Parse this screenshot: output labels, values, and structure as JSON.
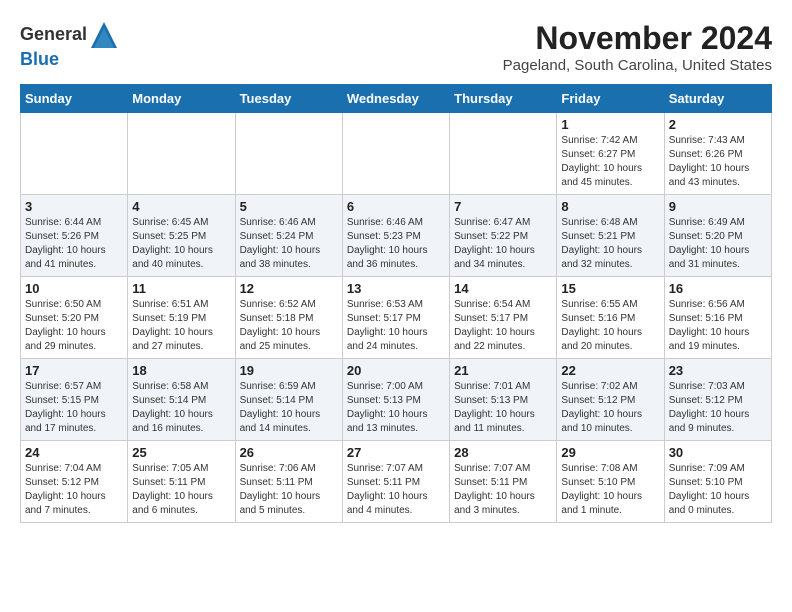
{
  "header": {
    "logo_line1": "General",
    "logo_line2": "Blue",
    "title": "November 2024",
    "subtitle": "Pageland, South Carolina, United States"
  },
  "weekdays": [
    "Sunday",
    "Monday",
    "Tuesday",
    "Wednesday",
    "Thursday",
    "Friday",
    "Saturday"
  ],
  "weeks": [
    [
      {
        "day": "",
        "info": ""
      },
      {
        "day": "",
        "info": ""
      },
      {
        "day": "",
        "info": ""
      },
      {
        "day": "",
        "info": ""
      },
      {
        "day": "",
        "info": ""
      },
      {
        "day": "1",
        "info": "Sunrise: 7:42 AM\nSunset: 6:27 PM\nDaylight: 10 hours\nand 45 minutes."
      },
      {
        "day": "2",
        "info": "Sunrise: 7:43 AM\nSunset: 6:26 PM\nDaylight: 10 hours\nand 43 minutes."
      }
    ],
    [
      {
        "day": "3",
        "info": "Sunrise: 6:44 AM\nSunset: 5:26 PM\nDaylight: 10 hours\nand 41 minutes."
      },
      {
        "day": "4",
        "info": "Sunrise: 6:45 AM\nSunset: 5:25 PM\nDaylight: 10 hours\nand 40 minutes."
      },
      {
        "day": "5",
        "info": "Sunrise: 6:46 AM\nSunset: 5:24 PM\nDaylight: 10 hours\nand 38 minutes."
      },
      {
        "day": "6",
        "info": "Sunrise: 6:46 AM\nSunset: 5:23 PM\nDaylight: 10 hours\nand 36 minutes."
      },
      {
        "day": "7",
        "info": "Sunrise: 6:47 AM\nSunset: 5:22 PM\nDaylight: 10 hours\nand 34 minutes."
      },
      {
        "day": "8",
        "info": "Sunrise: 6:48 AM\nSunset: 5:21 PM\nDaylight: 10 hours\nand 32 minutes."
      },
      {
        "day": "9",
        "info": "Sunrise: 6:49 AM\nSunset: 5:20 PM\nDaylight: 10 hours\nand 31 minutes."
      }
    ],
    [
      {
        "day": "10",
        "info": "Sunrise: 6:50 AM\nSunset: 5:20 PM\nDaylight: 10 hours\nand 29 minutes."
      },
      {
        "day": "11",
        "info": "Sunrise: 6:51 AM\nSunset: 5:19 PM\nDaylight: 10 hours\nand 27 minutes."
      },
      {
        "day": "12",
        "info": "Sunrise: 6:52 AM\nSunset: 5:18 PM\nDaylight: 10 hours\nand 25 minutes."
      },
      {
        "day": "13",
        "info": "Sunrise: 6:53 AM\nSunset: 5:17 PM\nDaylight: 10 hours\nand 24 minutes."
      },
      {
        "day": "14",
        "info": "Sunrise: 6:54 AM\nSunset: 5:17 PM\nDaylight: 10 hours\nand 22 minutes."
      },
      {
        "day": "15",
        "info": "Sunrise: 6:55 AM\nSunset: 5:16 PM\nDaylight: 10 hours\nand 20 minutes."
      },
      {
        "day": "16",
        "info": "Sunrise: 6:56 AM\nSunset: 5:16 PM\nDaylight: 10 hours\nand 19 minutes."
      }
    ],
    [
      {
        "day": "17",
        "info": "Sunrise: 6:57 AM\nSunset: 5:15 PM\nDaylight: 10 hours\nand 17 minutes."
      },
      {
        "day": "18",
        "info": "Sunrise: 6:58 AM\nSunset: 5:14 PM\nDaylight: 10 hours\nand 16 minutes."
      },
      {
        "day": "19",
        "info": "Sunrise: 6:59 AM\nSunset: 5:14 PM\nDaylight: 10 hours\nand 14 minutes."
      },
      {
        "day": "20",
        "info": "Sunrise: 7:00 AM\nSunset: 5:13 PM\nDaylight: 10 hours\nand 13 minutes."
      },
      {
        "day": "21",
        "info": "Sunrise: 7:01 AM\nSunset: 5:13 PM\nDaylight: 10 hours\nand 11 minutes."
      },
      {
        "day": "22",
        "info": "Sunrise: 7:02 AM\nSunset: 5:12 PM\nDaylight: 10 hours\nand 10 minutes."
      },
      {
        "day": "23",
        "info": "Sunrise: 7:03 AM\nSunset: 5:12 PM\nDaylight: 10 hours\nand 9 minutes."
      }
    ],
    [
      {
        "day": "24",
        "info": "Sunrise: 7:04 AM\nSunset: 5:12 PM\nDaylight: 10 hours\nand 7 minutes."
      },
      {
        "day": "25",
        "info": "Sunrise: 7:05 AM\nSunset: 5:11 PM\nDaylight: 10 hours\nand 6 minutes."
      },
      {
        "day": "26",
        "info": "Sunrise: 7:06 AM\nSunset: 5:11 PM\nDaylight: 10 hours\nand 5 minutes."
      },
      {
        "day": "27",
        "info": "Sunrise: 7:07 AM\nSunset: 5:11 PM\nDaylight: 10 hours\nand 4 minutes."
      },
      {
        "day": "28",
        "info": "Sunrise: 7:07 AM\nSunset: 5:11 PM\nDaylight: 10 hours\nand 3 minutes."
      },
      {
        "day": "29",
        "info": "Sunrise: 7:08 AM\nSunset: 5:10 PM\nDaylight: 10 hours\nand 1 minute."
      },
      {
        "day": "30",
        "info": "Sunrise: 7:09 AM\nSunset: 5:10 PM\nDaylight: 10 hours\nand 0 minutes."
      }
    ]
  ]
}
